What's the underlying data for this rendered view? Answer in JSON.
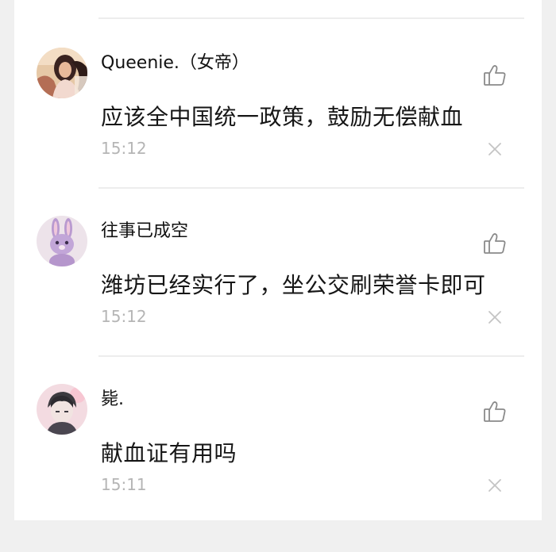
{
  "comments": [
    {
      "username": "Queenie.（女帝）",
      "text": "应该全中国统一政策，鼓励无偿献血",
      "time": "15:12",
      "avatar_icon": "woman-photo-avatar",
      "avatar_bg": "#d9a87a"
    },
    {
      "username": "往事已成空",
      "text": "潍坊已经实行了，坐公交刷荣誉卡即可",
      "time": "15:12",
      "avatar_icon": "purple-rabbit-avatar",
      "avatar_bg": "#e9dde6"
    },
    {
      "username": "毙.",
      "text": "献血证有用吗",
      "time": "15:11",
      "avatar_icon": "anime-boy-avatar",
      "avatar_bg": "#f1d6dd"
    }
  ],
  "icons": {
    "like": "thumbs-up-icon",
    "close": "close-icon"
  },
  "colors": {
    "background": "#f0f0f0",
    "card": "#ffffff",
    "text": "#161616",
    "muted": "#b5b5b5",
    "divider": "#ededed",
    "icon": "#8a8a8a"
  }
}
